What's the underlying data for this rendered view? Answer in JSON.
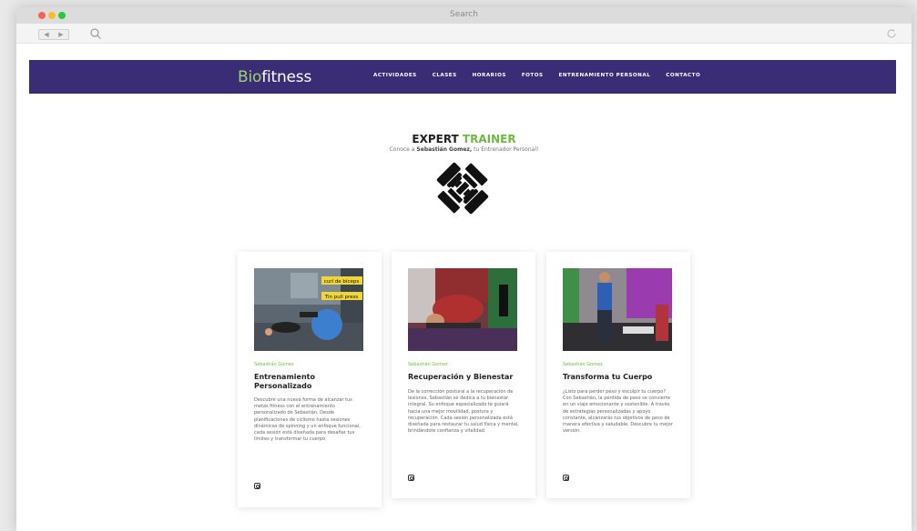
{
  "browser": {
    "title": "Search",
    "nav_back": "◀",
    "nav_forward": "▶",
    "search_icon": "search-icon",
    "reload_icon": "reload-icon"
  },
  "nav": {
    "logo_prefix": "Bio",
    "logo_suffix": "fitness",
    "menu": [
      "ACTIVIDADES",
      "CLASES",
      "HORARIOS",
      "FOTOS",
      "ENTRENAMIENTO PERSONAL",
      "CONTACTO"
    ],
    "bg_color": "#3a2d75",
    "logo_accent": "#9ad46a"
  },
  "hero": {
    "title_part1": "EXPERT",
    "title_part2": "TRAINER",
    "subtitle_prefix": "Conoce a",
    "subtitle_name": "Sebastián Gomez,",
    "subtitle_suffix": "tu Entrenador Personal!",
    "icon": "dumbbell-icon",
    "accent_color": "#6dbb45"
  },
  "cards": [
    {
      "author": "Sebastián Gomez",
      "title": "Entrenamiento Personalizado",
      "text": "Descubre una nueva forma de alcanzar tus metas fitness con el entrenamiento personalizado de Sebastián. Desde planificaciones de ciclismo hasta sesiones dinámicas de spinning y un enfoque funcional, cada sesión está diseñada para desafiar tus límites y transformar tu cuerpo.",
      "photo_labels": [
        "curl de bíceps",
        "Tin pull press"
      ],
      "icon": "instagram-icon"
    },
    {
      "author": "Sebastián Gomez",
      "title": "Recuperación y Bienestar",
      "text": "De la corrección postural a la recuperación de lesiones, Sebastián se dedica a tu bienestar integral. Su enfoque especializado te guiará hacia una mejor movilidad, postura y recuperación. Cada sesión personalizada está diseñada para restaurar tu salud física y mental, brindándote confianza y vitalidad.",
      "icon": "instagram-icon"
    },
    {
      "author": "Sebastián Gomez",
      "title": "Transforma tu Cuerpo",
      "text": "¿Listo para perder peso y esculpir tu cuerpo? Con Sebastián, la pérdida de peso se convierte en un viaje emocionante y sostenible. A través de estrategias personalizadas y apoyo constante, alcanzarás tus objetivos de peso de manera efectiva y saludable. Descubre tu mejor versión.",
      "icon": "instagram-icon"
    }
  ]
}
